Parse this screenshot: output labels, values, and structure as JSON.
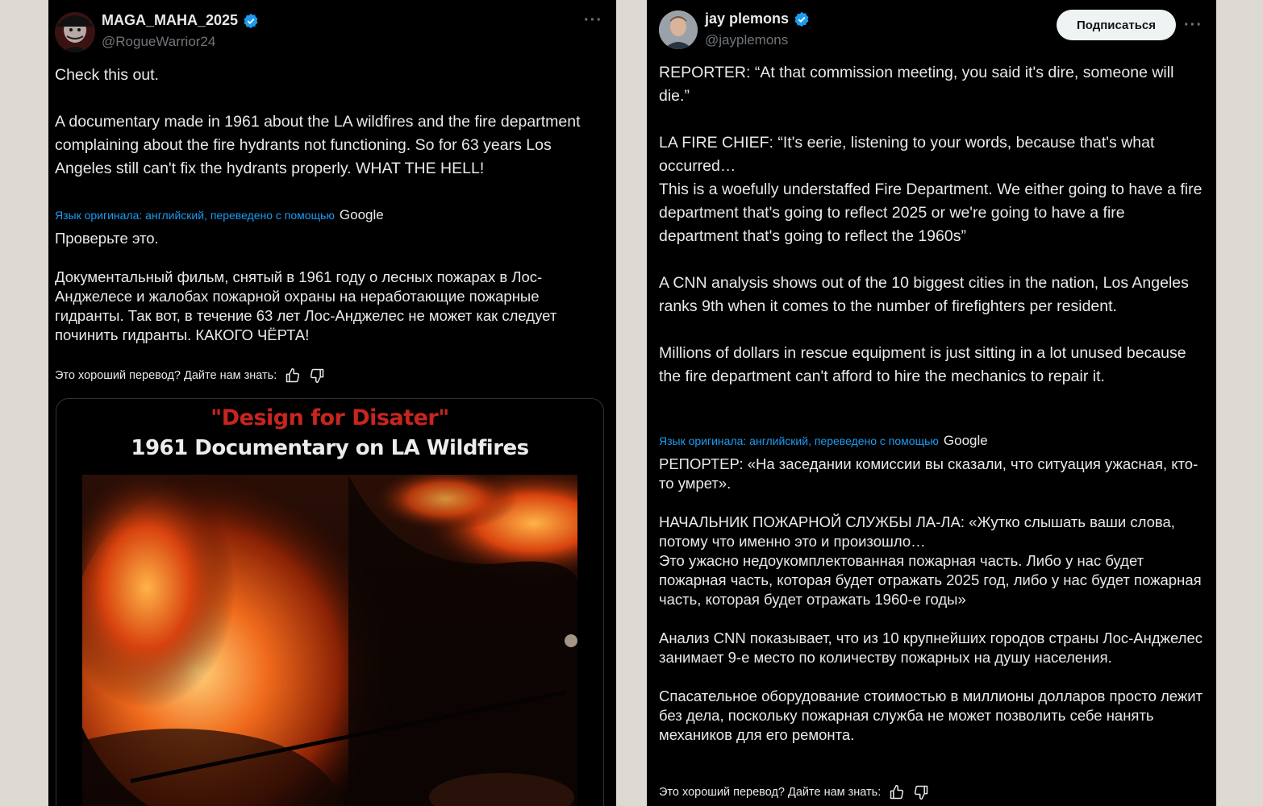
{
  "left_tweet": {
    "display_name": "MAGA_MAHA_2025",
    "handle": "@RogueWarrior24",
    "more_label": "···",
    "original_text": "Check this out.\n\nA documentary made in 1961 about the LA wildfires and the fire department complaining about the fire hydrants not functioning. So for 63 years Los Angeles still can't fix the hydrants properly. WHAT THE HELL!",
    "translation_note": "Язык оригинала: английский, переведено с помощью",
    "translation_provider": "Google",
    "translated_text": "Проверьте это.\n\nДокументальный фильм, снятый в 1961 году о лесных пожарах в Лос-Анджелесе и жалобах пожарной охраны на неработающие пожарные гидранты. Так вот, в течение 63 лет Лос-Анджелес не может как следует починить гидранты. КАКОГО ЧЁРТА!",
    "feedback_prompt": "Это хороший перевод? Дайте нам знать:",
    "video": {
      "title_red": "\"Design for Disater\"",
      "title_white": "1961 Documentary on LA Wildfires"
    }
  },
  "right_tweet": {
    "display_name": "jay plemons",
    "handle": "@jayplemons",
    "follow_label": "Подписаться",
    "more_label": "···",
    "original_text": "REPORTER: “At that commission meeting, you said it's dire, someone will die.”\n\nLA FIRE CHIEF: “It's eerie, listening to your words, because that's what occurred…\nThis is a woefully understaffed Fire Department. We either going to have a fire department that's going to reflect 2025 or we're going to have a fire department that's going to reflect the 1960s”\n\nA CNN analysis shows out of the 10 biggest cities in the nation, Los Angeles ranks 9th when it comes to the number of firefighters per resident.\n\nMillions of dollars in rescue equipment is just sitting in a lot unused because the fire department can't afford to hire the mechanics to repair it.",
    "translation_note": "Язык оригинала: английский, переведено с помощью",
    "translation_provider": "Google",
    "translated_text": "РЕПОРТЕР: «На заседании комиссии вы сказали, что ситуация ужасная, кто-то умрет».\n\nНАЧАЛЬНИК ПОЖАРНОЙ СЛУЖБЫ ЛА-ЛА: «Жутко слышать ваши слова, потому что именно это и произошло…\nЭто ужасно недоукомплектованная пожарная часть. Либо у нас будет пожарная часть, которая будет отражать 2025 год, либо у нас будет пожарная часть, которая будет отражать 1960-е годы»\n\nАнализ CNN показывает, что из 10 крупнейших городов страны Лос-Анджелес занимает 9-е место по количеству пожарных на душу населения.\n\nСпасательное оборудование стоимостью в миллионы долларов просто лежит без дела, поскольку пожарная служба не может позволить себе нанять механиков для его ремонта.",
    "feedback_prompt": "Это хороший перевод? Дайте нам знать:"
  },
  "colors": {
    "panel_bg": "#000000",
    "text": "#e7e9ea",
    "secondary": "#71767b",
    "link": "#1d9bf0",
    "verified": "#1d9bf0",
    "follow_bg": "#eff3f4",
    "title_red": "#c8251f",
    "page_bg": "#dcdad2"
  },
  "icons": {
    "verified": "verified-badge-icon",
    "more": "more-dots-icon",
    "thumbs_up": "thumbs-up-icon",
    "thumbs_down": "thumbs-down-icon"
  }
}
